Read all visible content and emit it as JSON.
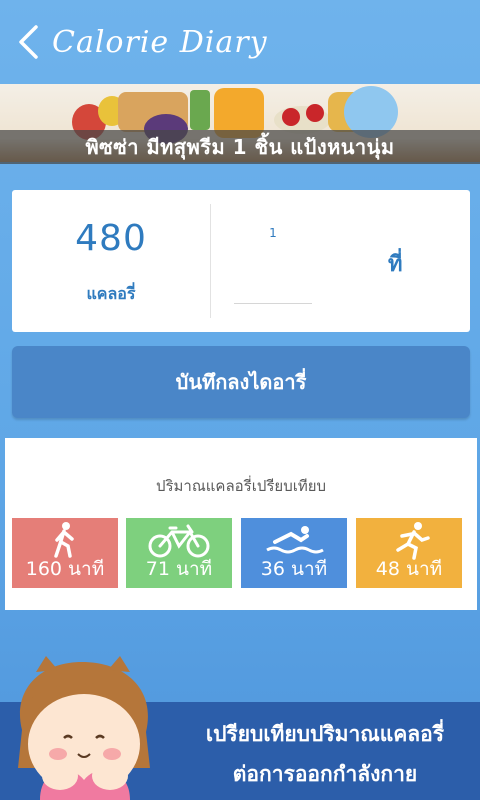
{
  "header": {
    "title": "Calorie Diary",
    "back_icon": "chevron-left-icon"
  },
  "banner": {
    "caption": "พิซซ่า มีทสุพรีม 1 ชิ้น แป้งหนานุ่ม"
  },
  "calorie_card": {
    "calories": "480",
    "calorie_unit": "แคลอรี่",
    "quantity": "1",
    "quantity_unit": "ที่"
  },
  "save_button": {
    "label": "บันทึกลงไดอารี่"
  },
  "comparison": {
    "title": "ปริมาณแคลอรี่เปรียบเทียบ",
    "activities": [
      {
        "icon": "walking-icon",
        "label": "160 นาที",
        "color": "#e57e78"
      },
      {
        "icon": "bicycle-icon",
        "label": "71 นาที",
        "color": "#7ed07e"
      },
      {
        "icon": "swimming-icon",
        "label": "36 นาที",
        "color": "#4f8fdc"
      },
      {
        "icon": "running-icon",
        "label": "48 นาที",
        "color": "#f2b13e"
      }
    ]
  },
  "promo": {
    "line1": "เปรียบเทียบปริมาณแคลอรี่",
    "line2": "ต่อการออกกำลังกาย"
  },
  "colors": {
    "accent": "#2f7bbf",
    "button": "#4a86c8",
    "footer": "#2c5eaa"
  }
}
